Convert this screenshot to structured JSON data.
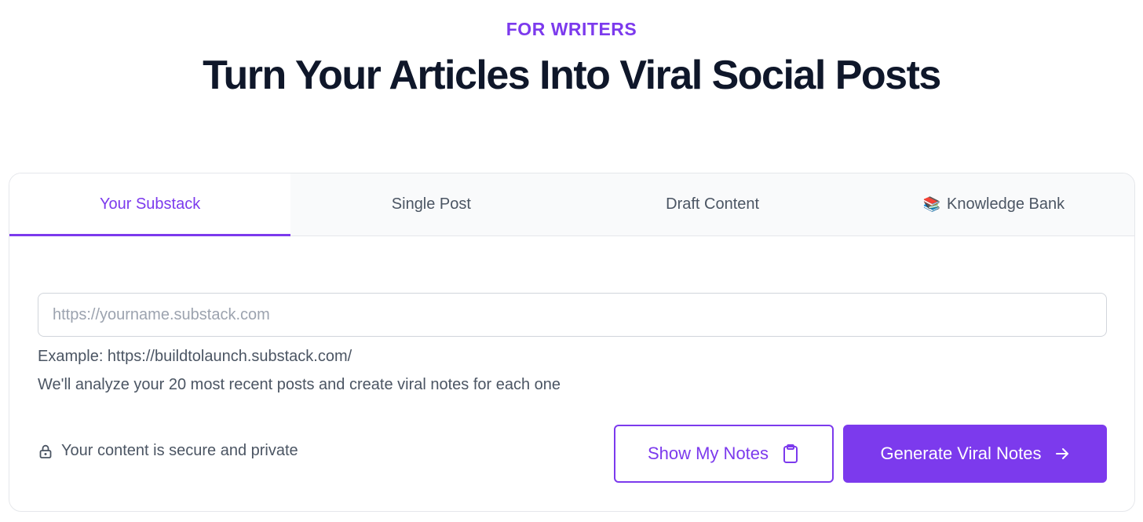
{
  "header": {
    "eyebrow": "FOR WRITERS",
    "title": "Turn Your Articles Into Viral Social Posts"
  },
  "tabs": [
    {
      "label": "Your Substack",
      "active": true
    },
    {
      "label": "Single Post",
      "active": false
    },
    {
      "label": "Draft Content",
      "active": false
    },
    {
      "label": "Knowledge Bank",
      "active": false,
      "icon": "books-emoji"
    }
  ],
  "form": {
    "url_value": "",
    "url_placeholder": "https://yourname.substack.com",
    "example_text": "Example: https://buildtolaunch.substack.com/",
    "analyze_text": "We'll analyze your 20 most recent posts and create viral notes for each one",
    "secure_text": "Your content is secure and private",
    "secure_icon": "lock-icon"
  },
  "actions": {
    "show_notes_label": "Show My Notes",
    "show_notes_icon": "clipboard-icon",
    "generate_label": "Generate Viral Notes",
    "generate_icon": "arrow-right-icon"
  },
  "colors": {
    "accent": "#7c3aed",
    "heading": "#0f172a",
    "muted_text": "#4b5563",
    "tab_bar_bg": "#f9fafb"
  }
}
